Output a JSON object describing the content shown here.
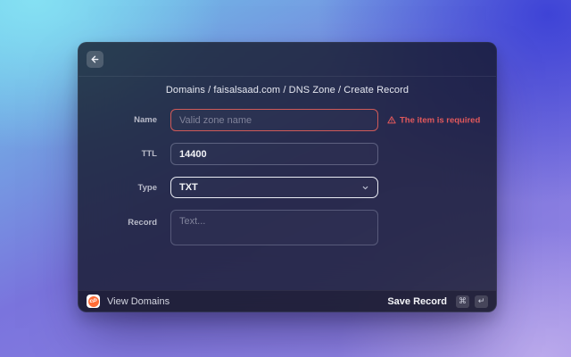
{
  "breadcrumb": "Domains / faisalsaad.com / DNS Zone / Create Record",
  "form": {
    "name": {
      "label": "Name",
      "placeholder": "Valid zone name",
      "error": "The item is required"
    },
    "ttl": {
      "label": "TTL",
      "value": "14400"
    },
    "type": {
      "label": "Type",
      "value": "TXT"
    },
    "record": {
      "label": "Record",
      "placeholder": "Text..."
    }
  },
  "footer": {
    "view_domains_label": "View Domains",
    "logo_text": "cP",
    "save_label": "Save Record",
    "keys": [
      "⌘",
      "↵"
    ]
  },
  "colors": {
    "error_red": "#e2595c",
    "logo_orange": "#ff6c37",
    "select_focus_border": "#e9ebf3"
  },
  "icons": {
    "back": "arrow-left",
    "alert": "warning-triangle",
    "select": "chevron-down",
    "shortcut_1": "command-key",
    "shortcut_2": "return-key"
  }
}
